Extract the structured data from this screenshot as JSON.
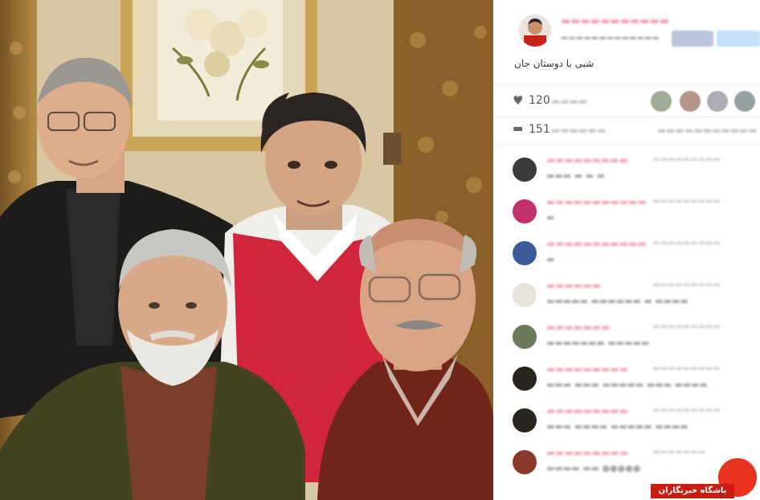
{
  "post": {
    "caption": "شبی با دوستان جان"
  },
  "stats": {
    "likes_count": "120",
    "comments_count": "151"
  },
  "watermark": {
    "text": "باشگاه خبرنگاران"
  },
  "colors": {
    "username": "#e24a6a",
    "facebook": "#3b5998",
    "twitter": "#55acee",
    "watermark_red": "#e8321e"
  },
  "icons": {
    "likes": "heart-icon",
    "comments": "speech-bubble-icon"
  }
}
